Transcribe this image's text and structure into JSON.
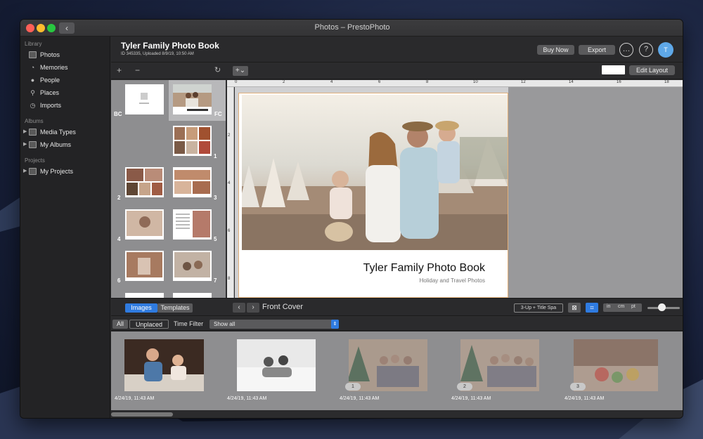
{
  "window": {
    "title": "Photos – PrestoPhoto"
  },
  "sidebar": {
    "library_heading": "Library",
    "library_items": [
      {
        "label": "Photos",
        "icon": "photos-icon"
      },
      {
        "label": "Memories",
        "icon": "memories-icon"
      },
      {
        "label": "People",
        "icon": "people-icon"
      },
      {
        "label": "Places",
        "icon": "places-icon"
      },
      {
        "label": "Imports",
        "icon": "imports-icon"
      }
    ],
    "albums_heading": "Albums",
    "album_items": [
      {
        "label": "Media Types",
        "icon": "folder-icon"
      },
      {
        "label": "My Albums",
        "icon": "folder-icon"
      }
    ],
    "projects_heading": "Projects",
    "project_items": [
      {
        "label": "My Projects",
        "icon": "folder-icon"
      }
    ]
  },
  "header": {
    "title": "Tyler Family Photo Book",
    "subtitle": "ID 345335, Uploaded 8/9/19, 10:50 AM",
    "buy_now": "Buy Now",
    "export": "Export",
    "avatar_initial": "T"
  },
  "toolbar": {
    "add": "+",
    "remove": "−",
    "edit_layout": "Edit Layout"
  },
  "pages": {
    "back_cover_label": "BC",
    "front_cover_label": "FC",
    "page_labels": [
      "1",
      "2",
      "3",
      "4",
      "5",
      "6",
      "7"
    ]
  },
  "ruler": {
    "h_ticks": [
      "0",
      "2",
      "4",
      "6",
      "8",
      "10",
      "12",
      "14",
      "16",
      "18"
    ],
    "v_ticks": [
      "2",
      "4",
      "6",
      "8"
    ]
  },
  "cover": {
    "title": "Tyler Family Photo Book",
    "subtitle": "Holiday and Travel Photos"
  },
  "footer": {
    "images_tab": "Images",
    "templates_tab": "Templates",
    "page_name": "Front Cover",
    "layout_name": "3-Up + Title Spa",
    "units": [
      "in",
      "cm",
      "pt"
    ]
  },
  "filter": {
    "all": "All",
    "unplaced": "Unplaced",
    "time_filter_label": "Time Filter",
    "time_filter_value": "Show all"
  },
  "strip": {
    "items": [
      {
        "date": "4/24/19, 11:43 AM",
        "badge": ""
      },
      {
        "date": "4/24/19, 11:43 AM",
        "badge": ""
      },
      {
        "date": "4/24/19, 11:43 AM",
        "badge": "1"
      },
      {
        "date": "4/24/19, 11:43 AM",
        "badge": "2"
      },
      {
        "date": "4/24/19, 11:43 AM",
        "badge": "3"
      }
    ]
  },
  "colors": {
    "accent": "#2f7be0",
    "avatar": "#5ea8e8",
    "selection": "#b8b8ba"
  }
}
